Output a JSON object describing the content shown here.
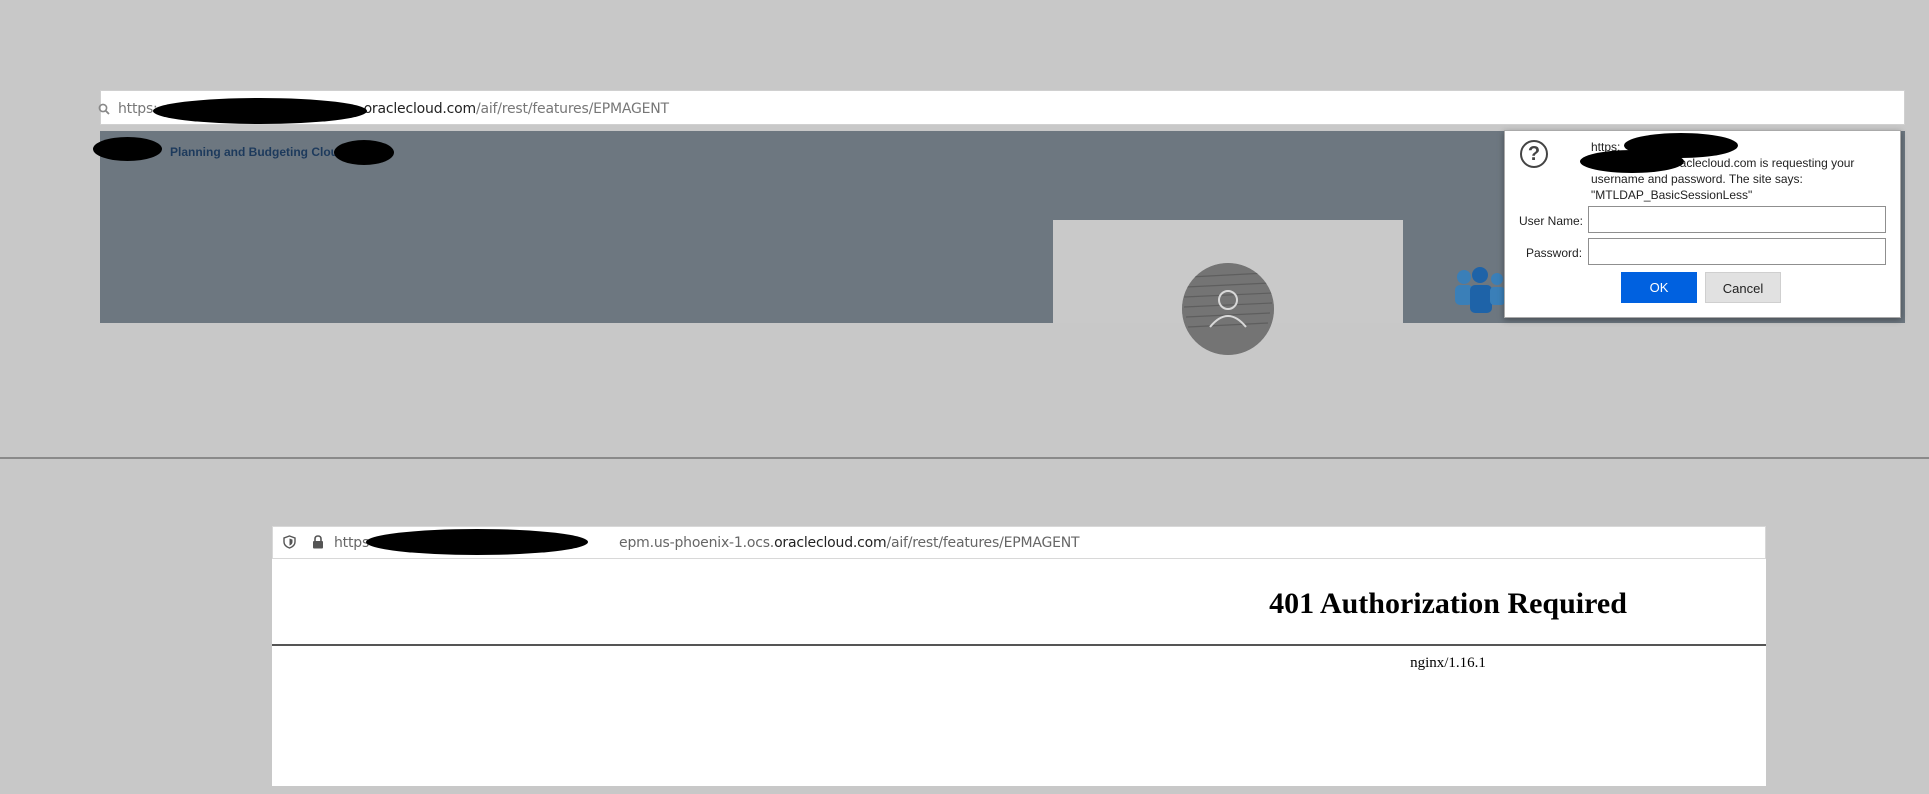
{
  "top_window": {
    "url_prefix": "https:",
    "url_host": "oraclecloud.com",
    "url_path": "/aif/rest/features/EPMAGENT",
    "app_title": "Planning and Budgeting Cloud",
    "icons": [
      "search-icon",
      "avatar-icon",
      "people-icon",
      "question-icon"
    ]
  },
  "auth_dialog": {
    "message_line1": "https:",
    "message_line2": "oraclecloud.com is requesting your",
    "message_line3": "username and password. The site says:",
    "message_line4": "\"MTLDAP_BasicSessionLess\"",
    "username_label": "User Name:",
    "username_value": "",
    "password_label": "Password:",
    "password_value": "",
    "ok_label": "OK",
    "cancel_label": "Cancel",
    "ok_color": "#0061e0"
  },
  "bottom_window": {
    "url_prefix": "https",
    "url_middle": "epm.us-phoenix-1.ocs.",
    "url_host": "oraclecloud.com",
    "url_path": "/aif/rest/features/EPMAGENT",
    "error_title": "401 Authorization Required",
    "server_line": "nginx/1.16.1",
    "icons": [
      "shield-icon",
      "lock-icon"
    ]
  }
}
